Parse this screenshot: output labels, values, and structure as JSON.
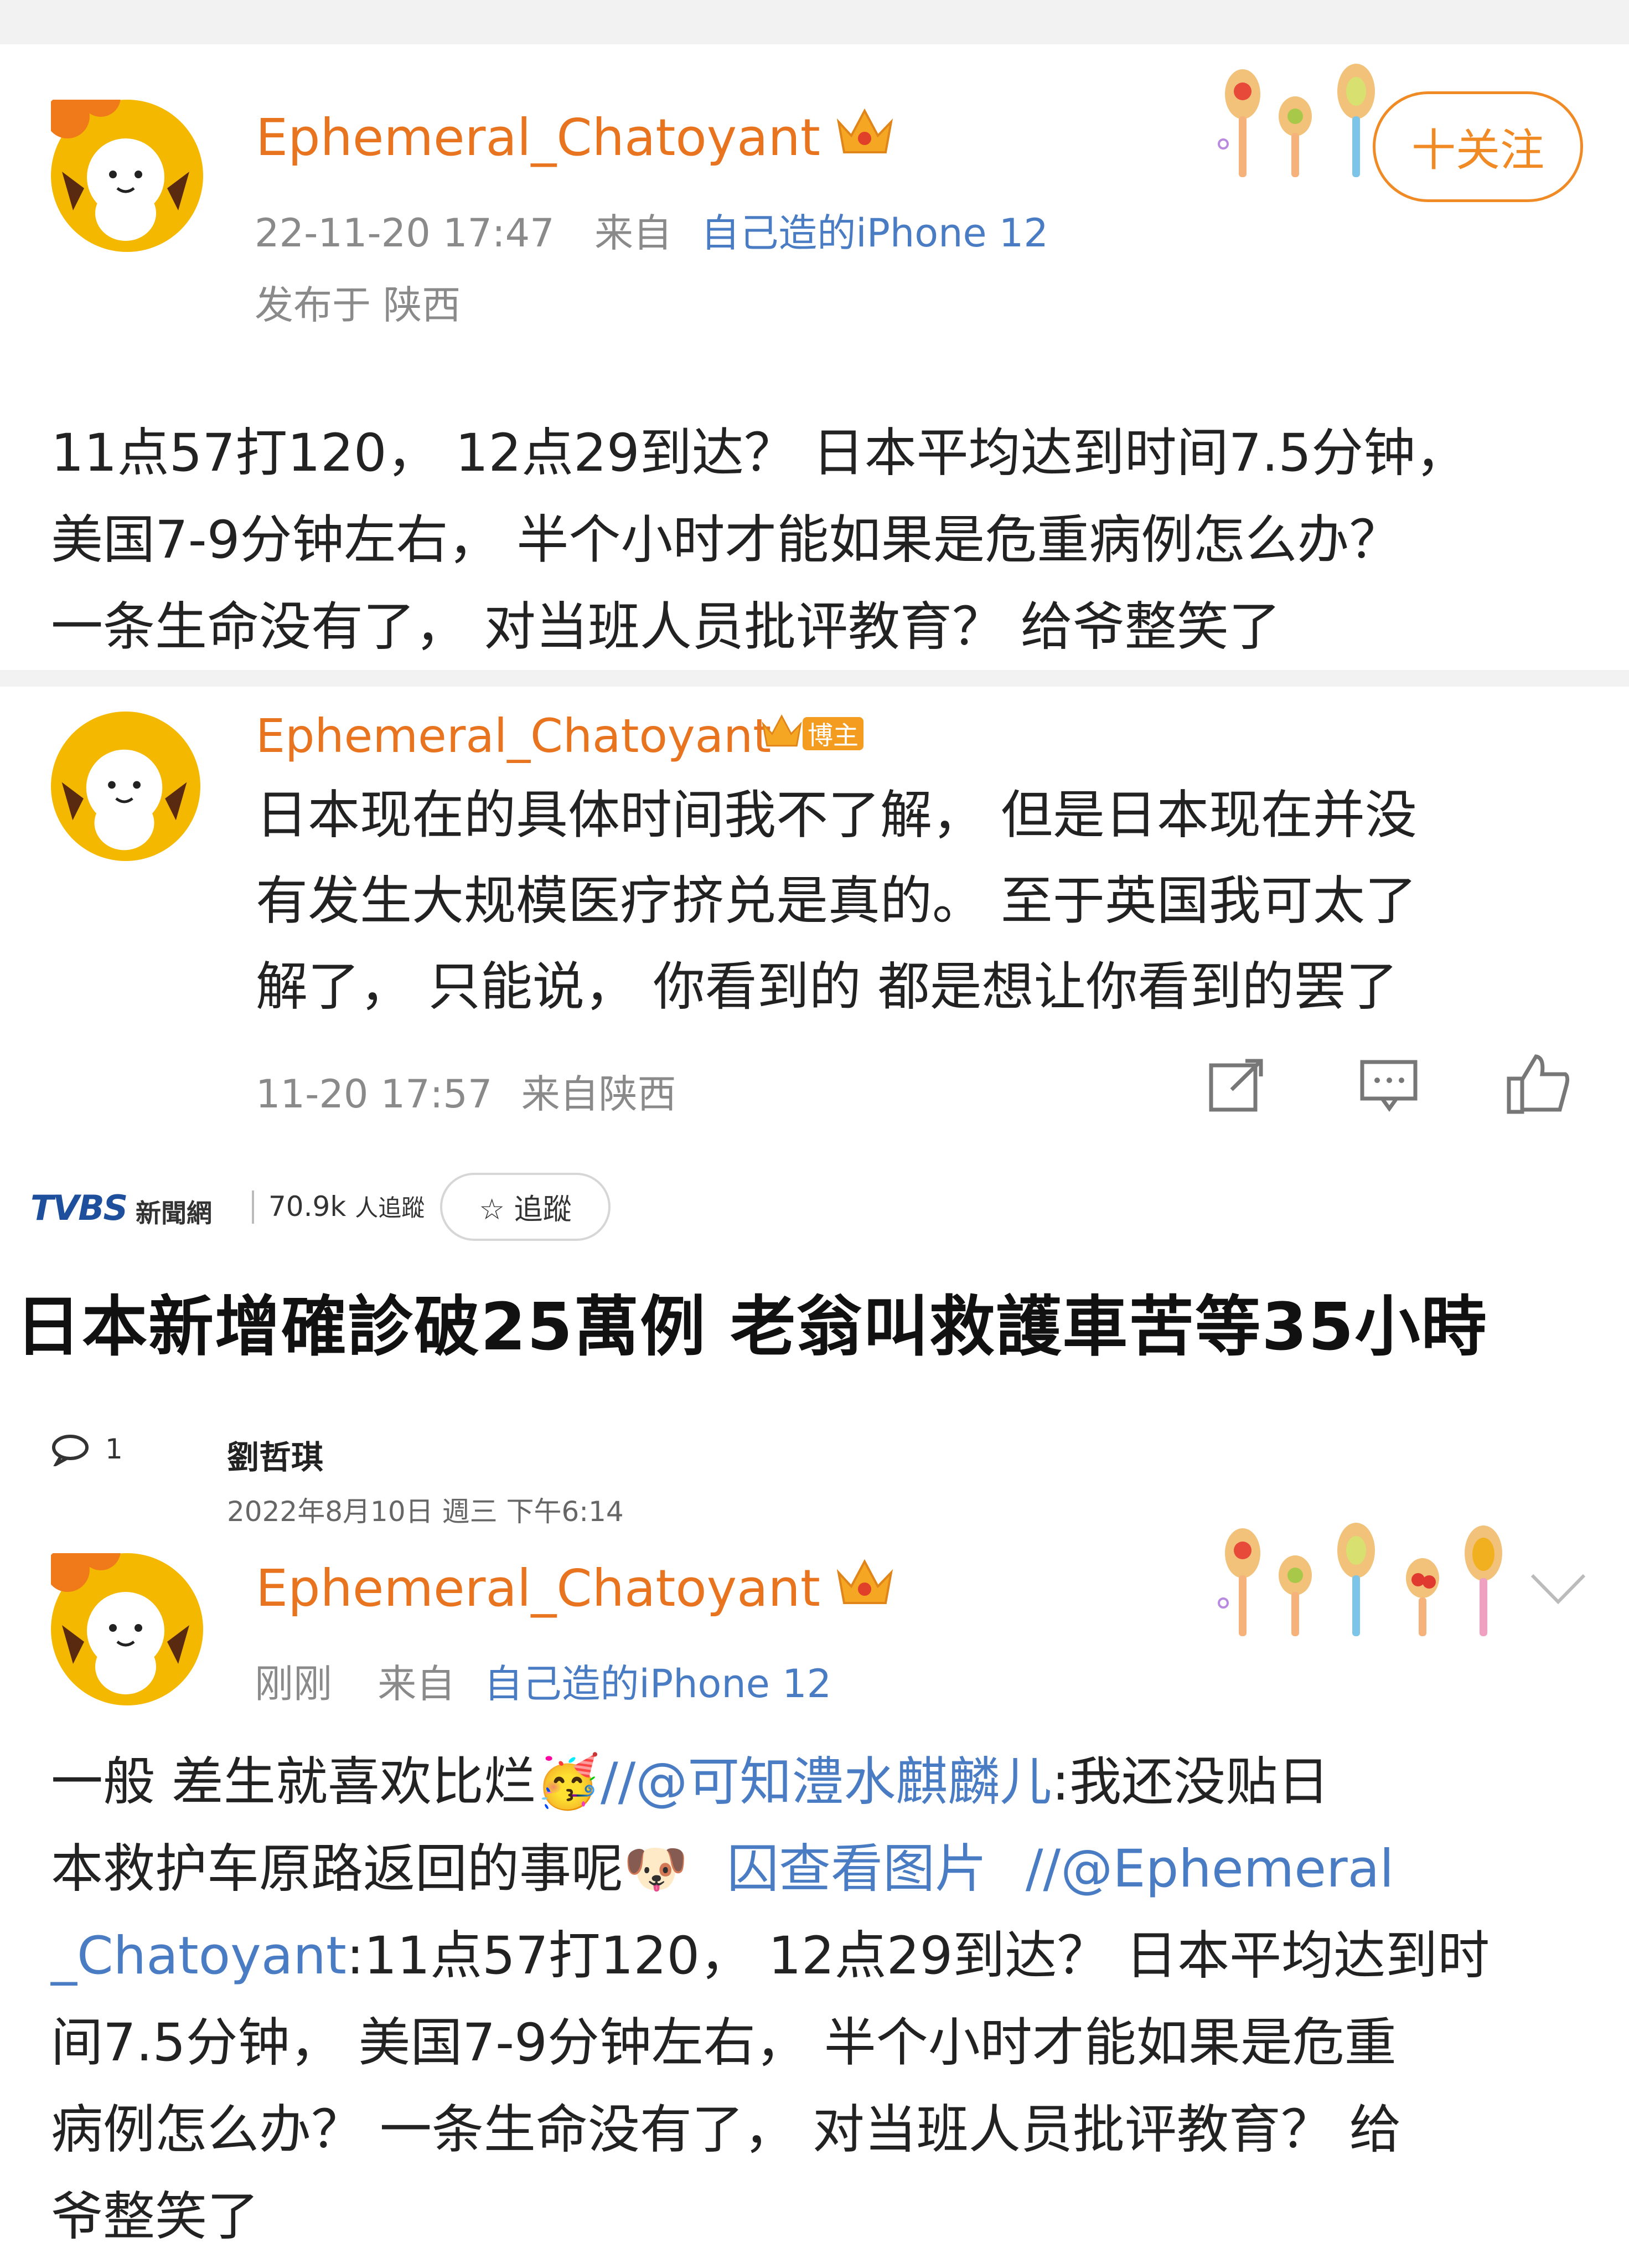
{
  "post1": {
    "username": "Ephemeral_Chatoyant",
    "time": "22-11-20 17:47",
    "from_label": "来自",
    "device": "自己造的iPhone 12",
    "location": "发布于 陕西",
    "follow_label": "十关注",
    "body_lines": [
      "11点57打120， 12点29到达？ 日本平均达到时间7.5分钟，",
      "美国7-9分钟左右， 半个小时才能如果是危重病例怎么办？",
      "一条生命没有了， 对当班人员批评教育？ 给爷整笑了"
    ]
  },
  "reply": {
    "username": "Ephemeral_Chatoyant",
    "badge": "博主",
    "body_lines": [
      "日本现在的具体时间我不了解， 但是日本现在并没",
      "有发生大规模医疗挤兑是真的。 至于英国我可太了",
      "解了， 只能说， 你看到的 都是想让你看到的罢了"
    ],
    "time": "11-20 17:57",
    "location": "来自陕西",
    "icons": [
      "share-icon",
      "comment-icon",
      "like-icon"
    ]
  },
  "tvbs": {
    "logo": "TVBS",
    "logo_cn": "新聞網",
    "followers": "70.9k",
    "followers_label": "人追蹤",
    "follow_label": "☆ 追蹤",
    "headline": "日本新增確診破25萬例 老翁叫救護車苦等35小時",
    "comment_count": "1",
    "author": "劉哲琪",
    "date": "2022年8月10日 週三 下午6:14"
  },
  "post2": {
    "username": "Ephemeral_Chatoyant",
    "time": "刚刚",
    "from_label": "来自",
    "device": "自己造的iPhone 12",
    "seg1": "一般 差生就喜欢比烂",
    "seg_emoji1": "🥳",
    "seg_mention1": "//@可知澧水麒麟儿",
    "seg2": ":我还没贴日",
    "seg3": "本救护车原路返回的事呢",
    "seg_emoji2": "🐶",
    "seg_viewimg": "囚查看图片",
    "seg_mention2a": " //@Ephemeral",
    "seg_mention2b": "_Chatoyant",
    "seg4": ":11点57打120， 12点29到达？ 日本平均达到时",
    "lines_rest": [
      "间7.5分钟， 美国7-9分钟左右， 半个小时才能如果是危重",
      "病例怎么办？ 一条生命没有了， 对当班人员批评教育？ 给",
      "爷整笑了"
    ]
  },
  "colors": {
    "username": "#e8741f",
    "link": "#4a7cc4",
    "meta": "#8a8a8a",
    "follow": "#f08a24",
    "avatar_bg": "#f5b800"
  }
}
